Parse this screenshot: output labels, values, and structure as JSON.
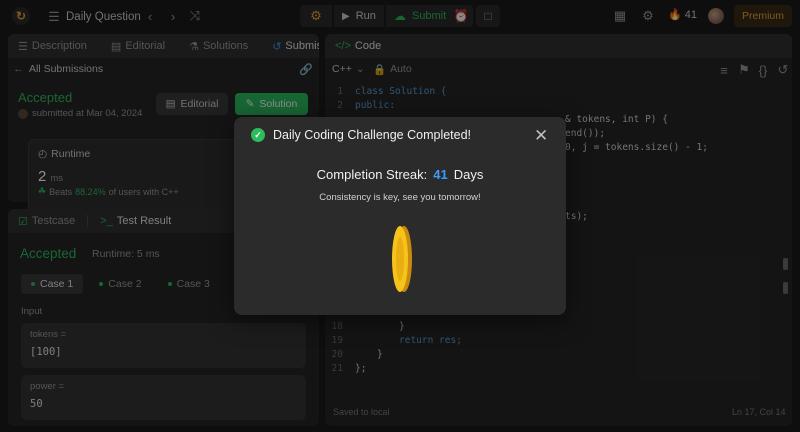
{
  "topbar": {
    "title": "Daily Question",
    "run_label": "Run",
    "submit_label": "Submit",
    "streak_count": "41",
    "premium_label": "Premium"
  },
  "left_top": {
    "tabs": [
      {
        "label": "Description"
      },
      {
        "label": "Editorial"
      },
      {
        "label": "Solutions"
      },
      {
        "label": "Submissions"
      }
    ],
    "back_label": "All Submissions",
    "status": "Accepted",
    "submitted_at": "submitted at Mar 04, 2024",
    "editorial_button": "Editorial",
    "solution_button": "Solution",
    "runtime_title": "Runtime",
    "runtime_value": "2",
    "runtime_unit": "ms",
    "beats_prefix": "Beats",
    "beats_percent": "88.24%",
    "beats_suffix": "of users with C++"
  },
  "left_bottom": {
    "tabs": [
      {
        "label": "Testcase"
      },
      {
        "label": "Test Result"
      }
    ],
    "status": "Accepted",
    "runtime_text": "Runtime: 5 ms",
    "cases": [
      {
        "label": "Case 1"
      },
      {
        "label": "Case 2"
      },
      {
        "label": "Case 3"
      }
    ],
    "input_label": "Input",
    "fields": [
      {
        "name": "tokens =",
        "value": "[100]"
      },
      {
        "name": "power =",
        "value": "50"
      }
    ]
  },
  "code_panel": {
    "title": "Code",
    "language": "C++",
    "mode": "Auto",
    "footer_left": "Saved to local",
    "footer_right": "Ln 17, Col 14",
    "lines": [
      {
        "num": "1",
        "text": "class Solution {"
      },
      {
        "num": "2",
        "text": "public:"
      },
      {
        "num": "",
        "text": "& tokens, int P) {"
      },
      {
        "num": "",
        "text": "end());"
      },
      {
        "num": "",
        "text": "0, j = tokens.size() - 1;"
      },
      {
        "num": "",
        "text": "ts);"
      },
      {
        "num": "18",
        "text": "}"
      },
      {
        "num": "19",
        "text": "return res;"
      },
      {
        "num": "20",
        "text": "}"
      },
      {
        "num": "21",
        "text": "};"
      }
    ]
  },
  "modal": {
    "title": "Daily Coding Challenge Completed!",
    "streak_label": "Completion Streak:",
    "streak_value": "41",
    "streak_unit": "Days",
    "message": "Consistency is key, see you tomorrow!"
  },
  "colors": {
    "accent_green": "#2cbb5d",
    "streak_blue": "#3b9cf5",
    "premium_orange": "#e7a13a",
    "coin_gold": "#f6c31a"
  }
}
